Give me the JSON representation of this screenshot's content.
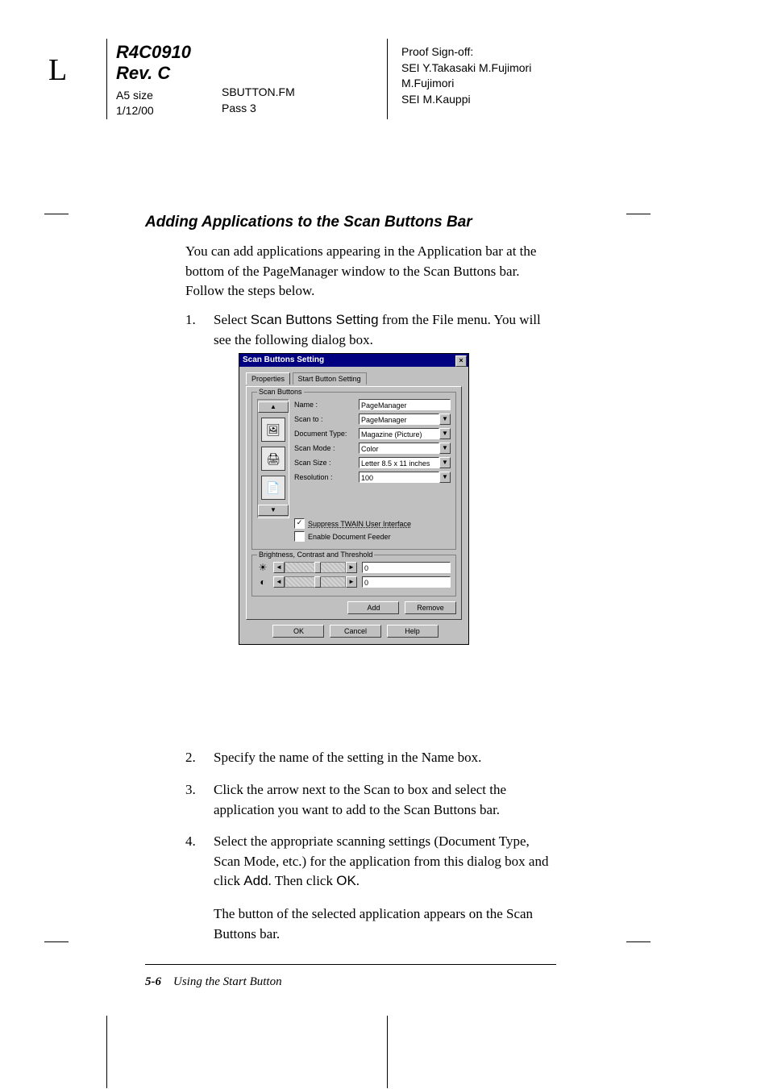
{
  "header": {
    "side_letter": "L",
    "doc_id": "R4C0910",
    "rev": "Rev. C",
    "paper": "A5 size",
    "date": "1/12/00",
    "file": "SBUTTON.FM",
    "pass": "Pass 3"
  },
  "proof": {
    "title": "Proof Sign-off:",
    "line1": "SEI Y.Takasaki M.Fujimori",
    "line2": "M.Fujimori",
    "line3": "SEI M.Kauppi"
  },
  "section_title": "Adding Applications to the Scan Buttons Bar",
  "para1": "You can add applications appearing in the Application bar at the bottom of the PageManager window to the Scan Buttons bar. Follow the steps below.",
  "steps": {
    "s1": {
      "n": "1.",
      "pre": "Select ",
      "ui": "Scan Buttons Setting",
      "post": " from the File menu. You will see the following dialog box."
    },
    "s2": {
      "n": "2.",
      "txt": "Specify the name of the setting in the Name box."
    },
    "s3": {
      "n": "3.",
      "txt": "Click the arrow next to the Scan to box and select the application you want to add to the Scan Buttons bar."
    },
    "s4": {
      "n": "4.",
      "pre": "Select the appropriate scanning settings (Document Type, Scan Mode, etc.) for the application from this dialog box and click ",
      "ui1": "Add",
      "mid": ". Then click ",
      "ui2": "OK",
      "post": "."
    },
    "s4b": "The button of the selected application appears on the Scan Buttons bar."
  },
  "dialog": {
    "title": "Scan Buttons Setting",
    "close": "×",
    "tabs": {
      "t1": "Properties",
      "t2": "Start Button Setting"
    },
    "group1": "Scan Buttons",
    "labels": {
      "name": "Name :",
      "scanto": "Scan to :",
      "doctype": "Document Type:",
      "scanmode": "Scan Mode :",
      "scansize": "Scan Size :",
      "resolution": "Resolution :"
    },
    "values": {
      "name": "PageManager",
      "scanto": "PageManager",
      "doctype": "Magazine (Picture)",
      "scanmode": "Color",
      "scansize": "Letter 8.5 x 11 inches",
      "resolution": "100"
    },
    "chk1": "Suppress TWAIN User Interface",
    "chk2": "Enable Document Feeder",
    "group2": "Brightness, Contrast and Threshold",
    "slider_val": "0",
    "buttons": {
      "add": "Add",
      "remove": "Remove",
      "ok": "OK",
      "cancel": "Cancel",
      "help": "Help"
    }
  },
  "footer": {
    "page": "5-6",
    "chapter": "Using the Start Button"
  }
}
